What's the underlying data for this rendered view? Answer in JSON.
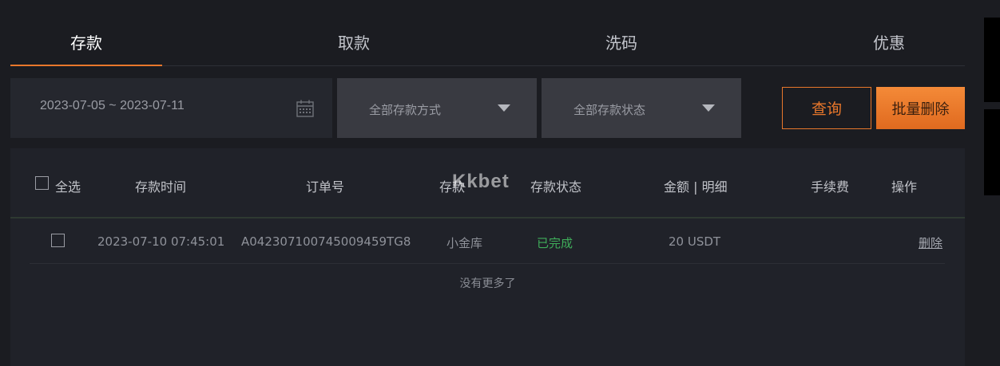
{
  "tabs": [
    {
      "label": "存款",
      "active": true
    },
    {
      "label": "取款",
      "active": false
    },
    {
      "label": "洗码",
      "active": false
    },
    {
      "label": "优惠",
      "active": false
    }
  ],
  "filters": {
    "date_range": "2023-07-05 ~ 2023-07-11",
    "method_select": "全部存款方式",
    "status_select": "全部存款状态"
  },
  "buttons": {
    "query": "查询",
    "batch_delete": "批量删除"
  },
  "table": {
    "headers": {
      "select_all": "全选",
      "time": "存款时间",
      "order": "订单号",
      "method": "存款",
      "status": "存款状态",
      "amount": "金额 | 明细",
      "fee": "手续费",
      "action": "操作"
    },
    "rows": [
      {
        "time": "2023-07-10 07:45:01",
        "order": "A042307100745009459TG8",
        "method": "小金库",
        "status": "已完成",
        "amount": "20 USDT",
        "fee": "",
        "action": "删除"
      }
    ],
    "footer": "没有更多了"
  },
  "watermark": "Kkbet",
  "colors": {
    "accent": "#e8772b",
    "status_complete": "#3fae5a",
    "background": "#1b1c21"
  }
}
